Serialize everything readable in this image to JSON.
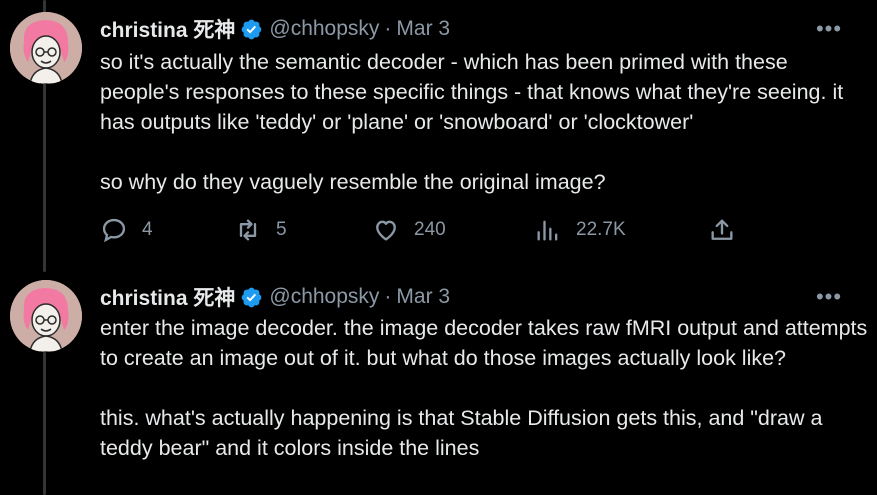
{
  "tweets": [
    {
      "author": {
        "name": "christina 死神",
        "handle": "@chhopsky"
      },
      "separator": "·",
      "date": "Mar 3",
      "more": "•••",
      "text": "so it's actually the semantic decoder - which has been primed with these people's responses to these specific things - that knows what they're seeing. it has outputs like 'teddy' or 'plane' or 'snowboard' or 'clocktower'\n\nso why do they vaguely resemble the original image?",
      "stats": {
        "replies": "4",
        "retweets": "5",
        "likes": "240",
        "views": "22.7K"
      },
      "icons": {
        "reply": "reply-icon",
        "retweet": "retweet-icon",
        "like": "heart-icon",
        "views": "views-icon",
        "share": "share-icon",
        "badge": "verified-badge-icon"
      }
    },
    {
      "author": {
        "name": "christina 死神",
        "handle": "@chhopsky"
      },
      "separator": "·",
      "date": "Mar 3",
      "more": "•••",
      "text": "enter the image decoder. the image decoder takes raw fMRI output and attempts to create an image out of it. but what do those images actually look like?\n\nthis. what's actually happening is that Stable Diffusion gets this, and \"draw a teddy bear\" and it colors inside the lines"
    }
  ],
  "colors": {
    "background": "#000000",
    "text": "#e7e9ea",
    "muted": "#8b98a5",
    "verified": "#1d9bf0",
    "thread": "#333639"
  }
}
